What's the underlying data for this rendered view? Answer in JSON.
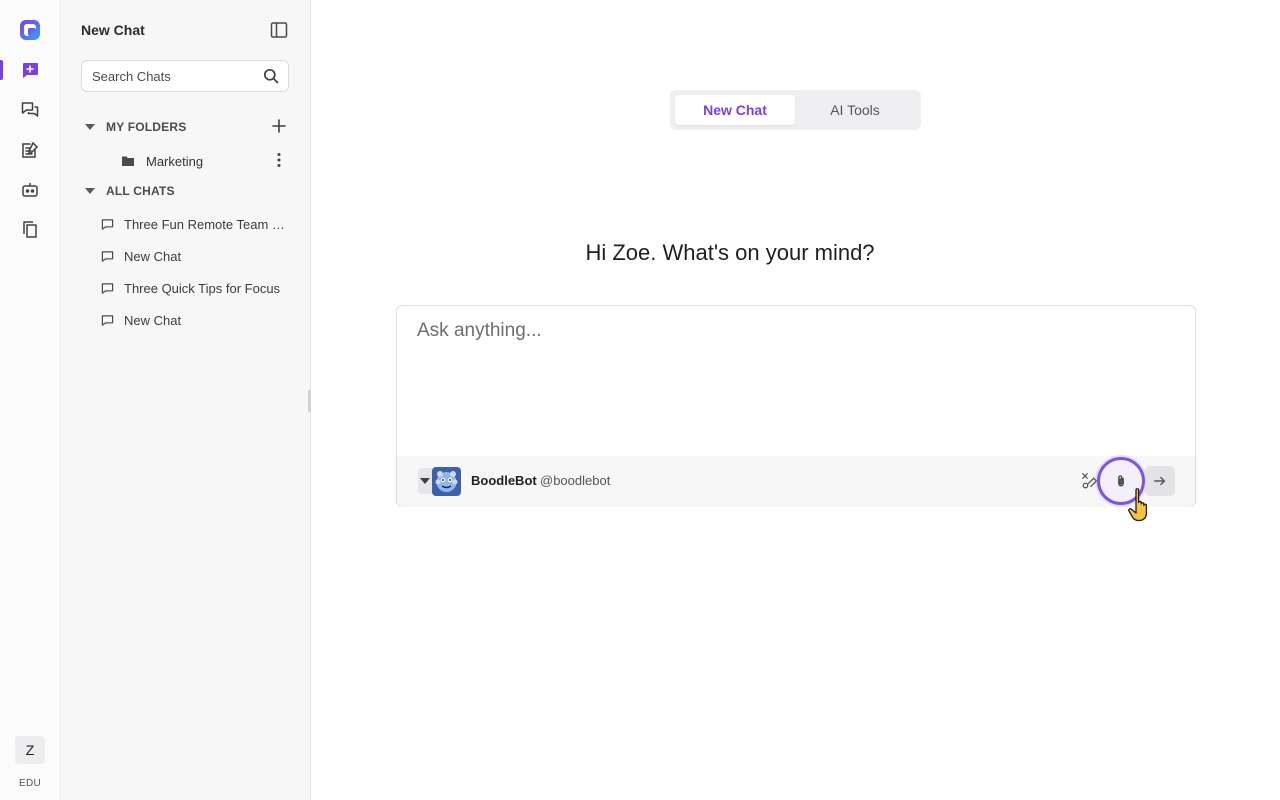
{
  "rail": {
    "avatar_initial": "Z",
    "plan_label": "EDU",
    "items": [
      {
        "name": "new-chat",
        "icon": "chat-plus-icon",
        "active": true
      },
      {
        "name": "chats",
        "icon": "chats-icon"
      },
      {
        "name": "prompts",
        "icon": "edit-note-icon"
      },
      {
        "name": "bots",
        "icon": "robot-icon"
      },
      {
        "name": "files",
        "icon": "copy-docs-icon"
      }
    ]
  },
  "sidebar": {
    "title": "New Chat",
    "search_placeholder": "Search Chats",
    "my_folders_label": "MY FOLDERS",
    "folders": [
      {
        "label": "Marketing"
      }
    ],
    "all_chats_label": "ALL CHATS",
    "chats": [
      {
        "label": "Three Fun Remote Team Building Activities"
      },
      {
        "label": "New Chat"
      },
      {
        "label": "Three Quick Tips for Focus"
      },
      {
        "label": "New Chat"
      }
    ]
  },
  "main": {
    "tabs": [
      {
        "label": "New Chat",
        "active": true
      },
      {
        "label": "AI Tools",
        "active": false
      }
    ],
    "greeting": "Hi Zoe. What's on your mind?",
    "composer": {
      "placeholder": "Ask anything...",
      "bot_name": "BoodleBot",
      "bot_handle": "@boodlebot"
    }
  },
  "colors": {
    "accent": "#7b3fe4",
    "sidebar_bg": "#f7f7f8",
    "focus_ring": "#7b55e0"
  }
}
